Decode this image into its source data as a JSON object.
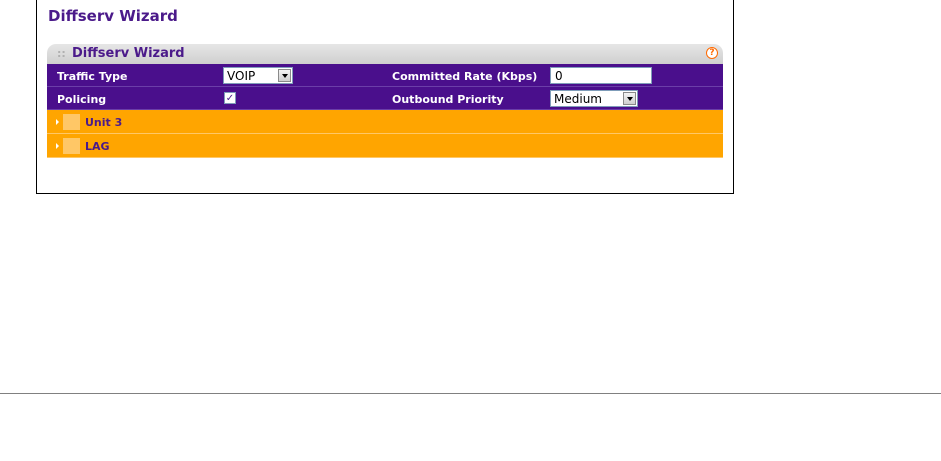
{
  "page": {
    "title": "Diffserv Wizard"
  },
  "panel": {
    "title": "Diffserv Wizard",
    "dots": "::",
    "help_icon_text": "?"
  },
  "form": {
    "traffic_type": {
      "label": "Traffic Type",
      "value": "VOIP"
    },
    "committed_rate": {
      "label": "Committed Rate (Kbps)",
      "value": "0"
    },
    "policing": {
      "label": "Policing",
      "checked": true,
      "check_glyph": "✓"
    },
    "outbound_priority": {
      "label": "Outbound Priority",
      "value": "Medium"
    }
  },
  "sections": [
    {
      "label": "Unit 3"
    },
    {
      "label": "LAG"
    }
  ],
  "colors": {
    "title": "#4b1a8a",
    "form_row_bg": "#4a0f8c",
    "section_bg": "#ffa500",
    "help_icon": "#ff6a00"
  }
}
